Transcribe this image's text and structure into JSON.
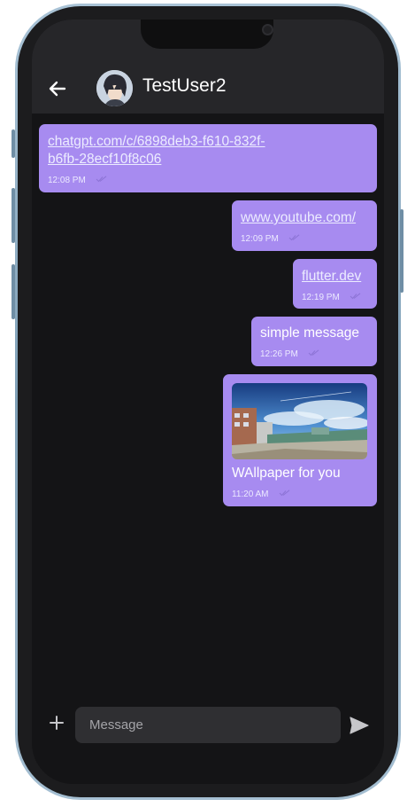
{
  "header": {
    "contact_name": "TestUser2"
  },
  "messages": [
    {
      "text": "chatgpt.com/c/6898deb3-f610-832f-b6fb-28ecf10f8c06",
      "line1": "chatgpt.com/c/6898deb3-f610-832f-",
      "line2": "b6fb-28ecf10f8c06",
      "time": "12:08 PM",
      "is_link": true
    },
    {
      "text": "www.youtube.com/",
      "time": "12:09 PM",
      "is_link": true
    },
    {
      "text": "flutter.dev",
      "time": "12:19 PM",
      "is_link": true
    },
    {
      "text": "simple message",
      "time": "12:26 PM",
      "is_link": false
    },
    {
      "text": "WAllpaper for you",
      "time": "11:20 AM",
      "is_link": false,
      "has_image": true
    }
  ],
  "composer": {
    "placeholder": "Message"
  },
  "colors": {
    "bubble": "#a78bf0",
    "background": "#141416",
    "appbar": "#262629"
  },
  "icons": {
    "back": "arrow-left-icon",
    "attach": "plus-icon",
    "send": "send-icon",
    "read": "double-check-icon"
  }
}
